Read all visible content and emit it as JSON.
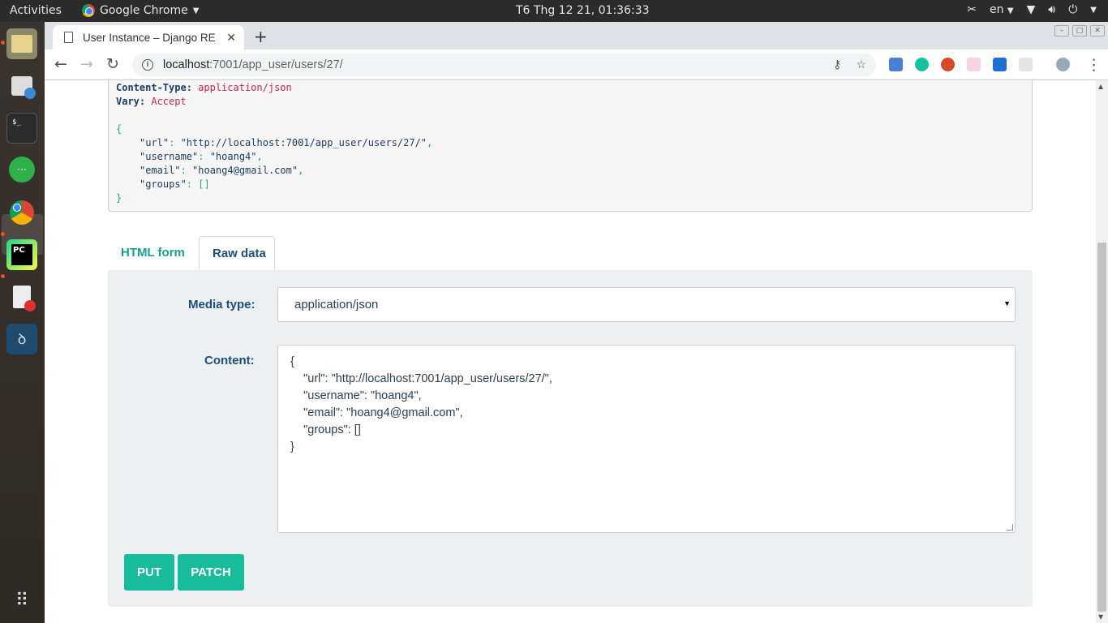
{
  "topbar": {
    "activities": "Activities",
    "app_name": "Google Chrome",
    "clock": "T6 Thg 12 21, 01:36:33",
    "language": "en"
  },
  "dock": {
    "items": [
      "files-app",
      "software-updater",
      "terminal",
      "whatsapp",
      "chrome",
      "pycharm",
      "text-editor",
      "mysql-workbench",
      "show-apps"
    ]
  },
  "browser": {
    "tab_title": "User Instance – Django RE",
    "address_host": "localhost",
    "address_path": ":7001/app_user/users/27/"
  },
  "response": {
    "headers": [
      {
        "key": "Content-Type:",
        "value": "application/json"
      },
      {
        "key": "Vary:",
        "value": "Accept"
      }
    ],
    "open_brace": "{",
    "close_brace": "}",
    "fields": [
      {
        "key": "\"url\"",
        "value": "\"http://localhost:7001/app_user/users/27/\"",
        "comma": ","
      },
      {
        "key": "\"username\"",
        "value": "\"hoang4\"",
        "comma": ","
      },
      {
        "key": "\"email\"",
        "value": "\"hoang4@gmail.com\"",
        "comma": ","
      },
      {
        "key": "\"groups\"",
        "value": "[]",
        "comma": ""
      }
    ]
  },
  "form": {
    "tabs": {
      "html_form": "HTML form",
      "raw_data": "Raw data"
    },
    "media_type_label": "Media type:",
    "media_type_value": "application/json",
    "content_label": "Content:",
    "content_value": "{\n    \"url\": \"http://localhost:7001/app_user/users/27/\",\n    \"username\": \"hoang4\",\n    \"email\": \"hoang4@gmail.com\",\n    \"groups\": []\n}",
    "put_label": "PUT",
    "patch_label": "PATCH"
  },
  "colors": {
    "accent": "#18bc9c",
    "heading": "#1d4f7a",
    "header_value": "#c7254e"
  }
}
